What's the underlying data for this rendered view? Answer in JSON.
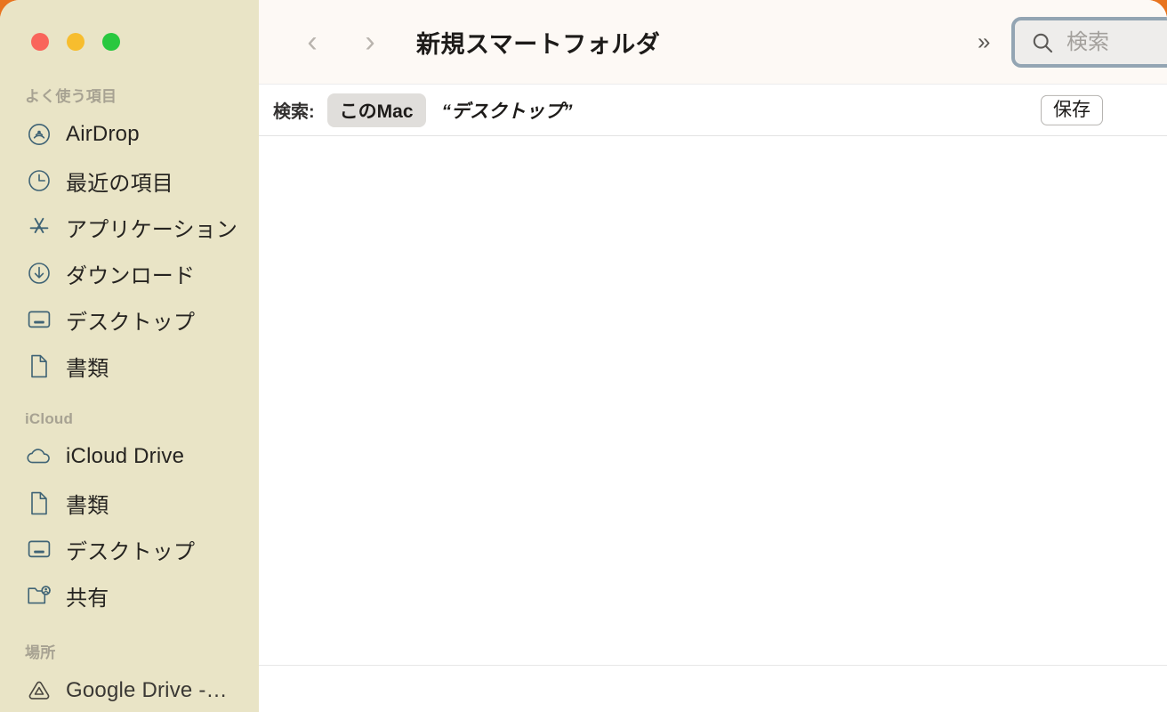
{
  "window": {
    "title": "新規スマートフォルダ",
    "traffic_lights": [
      {
        "name": "close",
        "color": "#f9655b"
      },
      {
        "name": "minimize",
        "color": "#f7bd2e"
      },
      {
        "name": "maximize",
        "color": "#29c83f"
      }
    ]
  },
  "toolbar": {
    "back_glyph": "‹",
    "forward_glyph": "›",
    "overflow_glyph": "»",
    "search": {
      "placeholder": "検索",
      "value": "",
      "icon": "search-icon",
      "focused": true,
      "focus_ring_color": "#93a5b3"
    }
  },
  "criteria_bar": {
    "label": "検索:",
    "scope_chip": "このMac",
    "scope_secondary": "“デスクトップ”",
    "save_label": "保存",
    "add_label": "+"
  },
  "annotation": {
    "highlight_target": "add-criteria-button",
    "color": "#fc0d1c"
  },
  "sidebar": {
    "background": "#e9e4c6",
    "sections": [
      {
        "title": "よく使う項目",
        "items": [
          {
            "label": "AirDrop",
            "icon": "airdrop-icon"
          },
          {
            "label": "最近の項目",
            "icon": "clock-icon"
          },
          {
            "label": "アプリケーション",
            "icon": "applications-icon"
          },
          {
            "label": "ダウンロード",
            "icon": "download-icon"
          },
          {
            "label": "デスクトップ",
            "icon": "desktop-icon"
          },
          {
            "label": "書類",
            "icon": "document-icon"
          }
        ]
      },
      {
        "title": "iCloud",
        "items": [
          {
            "label": "iCloud Drive",
            "icon": "cloud-icon"
          },
          {
            "label": "書類",
            "icon": "document-icon"
          },
          {
            "label": "デスクトップ",
            "icon": "desktop-icon"
          },
          {
            "label": "共有",
            "icon": "shared-folder-icon"
          }
        ]
      },
      {
        "title": "場所",
        "items": [
          {
            "label": "Google Drive -…",
            "icon": "google-drive-icon"
          }
        ]
      }
    ]
  }
}
